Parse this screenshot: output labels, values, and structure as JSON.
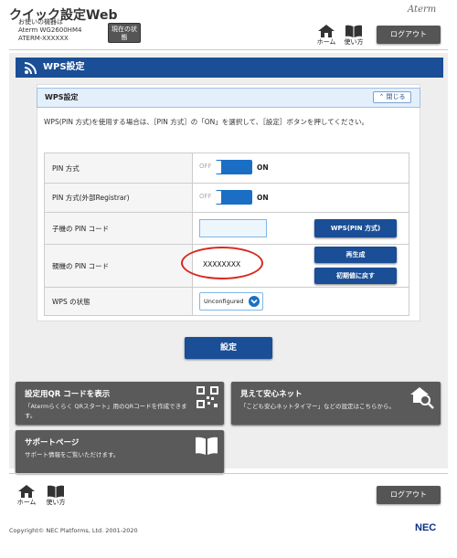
{
  "header": {
    "app_title": "クイック設定Web",
    "device_caption": "お使いの機器は",
    "device_model": "Aterm WG2600HM4",
    "device_id": "ATERM-XXXXXX",
    "status_button": "現在の状態",
    "brand": "Aterm",
    "nav_home": "ホーム",
    "nav_manual": "使い方",
    "logout": "ログアウト"
  },
  "page": {
    "title": "WPS設定"
  },
  "section": {
    "title": "WPS設定",
    "close_button": "閉じる",
    "description": "WPS(PIN 方式)を使用する場合は、［PIN 方式］の「ON」を選択して、［設定］ボタンを押してください。"
  },
  "settings": {
    "pin_method_label": "PIN 方式",
    "pin_method_off": "OFF",
    "pin_method_on": "ON",
    "pin_external_label": "PIN 方式(外部Registrar)",
    "pin_external_off": "OFF",
    "pin_external_on": "ON",
    "child_pin_label": "子機の PIN コード",
    "child_pin_value": "",
    "wps_pin_button": "WPS(PIN 方式)",
    "parent_pin_label": "親機の PIN コード",
    "parent_pin_value": "XXXXXXXX",
    "regenerate_button": "再生成",
    "reset_button": "初期値に戻す",
    "wps_status_label": "WPS の状態",
    "wps_status_value": "Unconfigured"
  },
  "actions": {
    "apply_button": "設定"
  },
  "tiles": [
    {
      "title": "設定用QR コードを表示",
      "subtitle": "「Atermらくらく QRスタート」用のQRコードを作成できます。",
      "icon": "qr-code-icon"
    },
    {
      "title": "見えて安心ネット",
      "subtitle": "「こども安心ネットタイマー」などの設定はこちらから。",
      "icon": "house-search-icon"
    },
    {
      "title": "サポートページ",
      "subtitle": "サポート情報をご覧いただけます。",
      "icon": "book-icon"
    }
  ],
  "footer": {
    "nav_home": "ホーム",
    "nav_manual": "使い方",
    "logout": "ログアウト",
    "copyright": "Copyright© NEC Platforms, Ltd. 2001-2020",
    "nec_logo": "NEC"
  },
  "colors": {
    "primary_blue": "#1a4e96",
    "toggle_blue": "#1a6fc4",
    "tile_gray": "#5a5a5a",
    "highlight_red": "#d9281e"
  }
}
